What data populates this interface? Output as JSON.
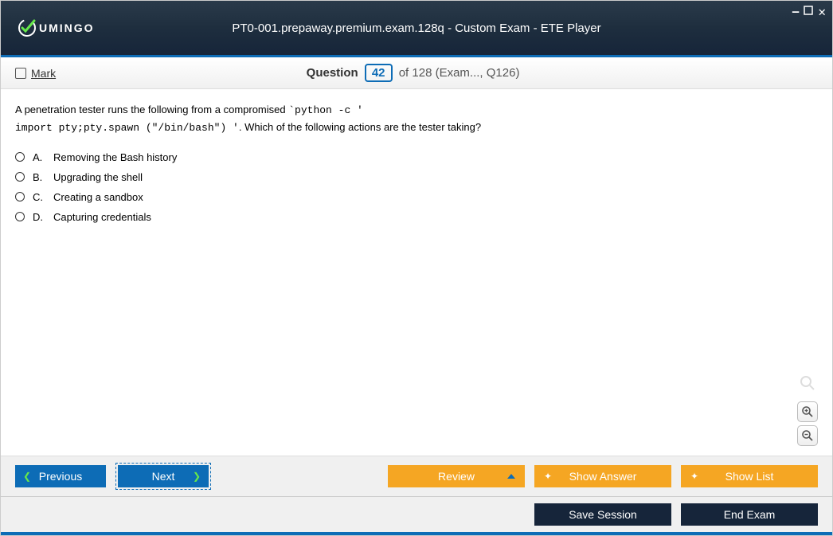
{
  "window": {
    "title": "PT0-001.prepaway.premium.exam.128q - Custom Exam - ETE Player",
    "logo_text": "UMINGO"
  },
  "header": {
    "mark_label": "Mark",
    "question_label": "Question",
    "question_number": "42",
    "of_text": "of 128",
    "context": "(Exam..., Q126)"
  },
  "question": {
    "text_part1": "A penetration tester runs the following from a compromised ",
    "code1": "`python -c '",
    "code2": "import pty;pty.spawn (\"/bin/bash\") '",
    "text_part2": ". Which of the following actions are the tester taking?"
  },
  "options": [
    {
      "letter": "A.",
      "text": "Removing the Bash history"
    },
    {
      "letter": "B.",
      "text": "Upgrading the shell"
    },
    {
      "letter": "C.",
      "text": "Creating a sandbox"
    },
    {
      "letter": "D.",
      "text": "Capturing credentials"
    }
  ],
  "footer": {
    "previous": "Previous",
    "next": "Next",
    "review": "Review",
    "show_answer": "Show Answer",
    "show_list": "Show List",
    "save_session": "Save Session",
    "end_exam": "End Exam"
  }
}
